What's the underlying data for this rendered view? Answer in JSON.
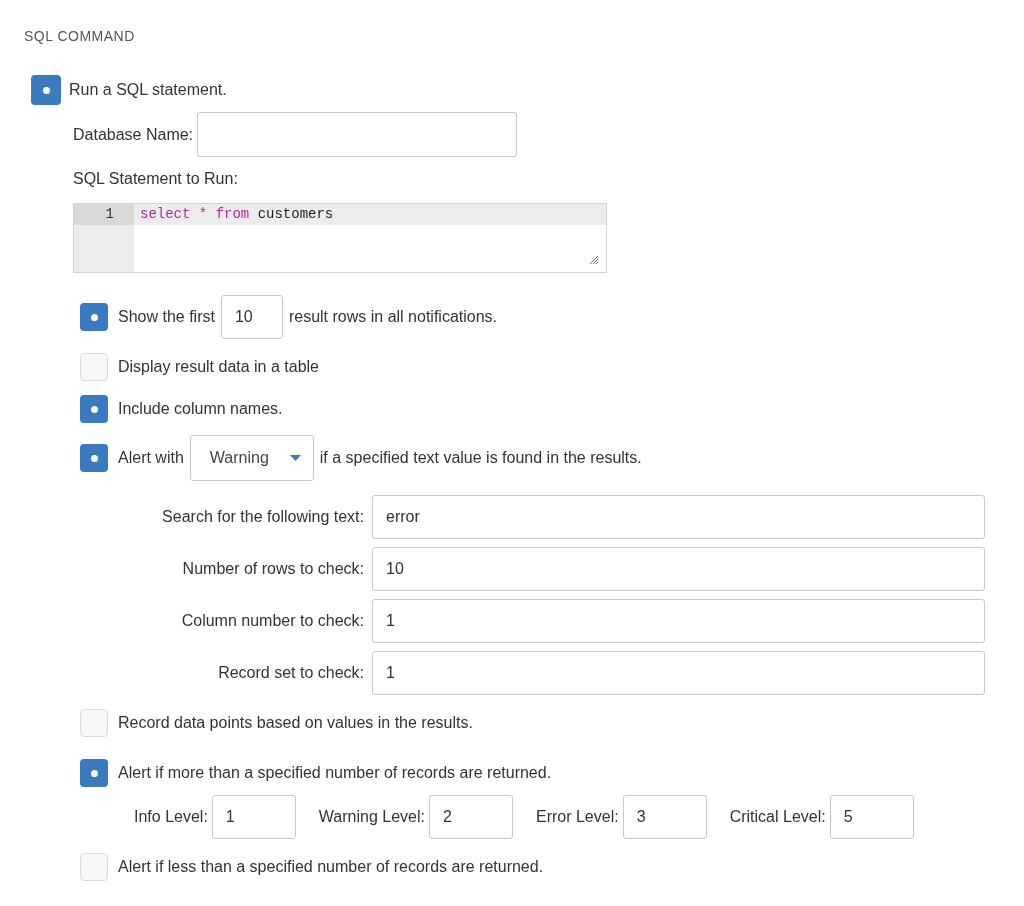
{
  "heading": "SQL COMMAND",
  "run_sql": {
    "label": "Run a SQL statement.",
    "checked": true,
    "database_label": "Database Name:",
    "statement_label": "SQL Statement to Run:",
    "line_number": "1",
    "code_tokens": [
      {
        "kind": "keyword",
        "text": "select"
      },
      {
        "kind": "keyword",
        "text": "*"
      },
      {
        "kind": "keyword",
        "text": "from"
      },
      {
        "kind": "plain",
        "text": "customers"
      }
    ]
  },
  "options": [
    {
      "kind": "inline_input",
      "checked": true,
      "before": "Show the first",
      "value": "10",
      "after": "result rows in all notifications."
    },
    {
      "kind": "plain",
      "checked": false,
      "label": "Display result data in a table"
    },
    {
      "kind": "plain",
      "checked": true,
      "label": "Include column names."
    },
    {
      "kind": "inline_select",
      "checked": true,
      "before": "Alert with",
      "value": "Warning",
      "after": "if a specified text value is found in the results.",
      "fields": [
        {
          "label": "Search for the following text:",
          "value": "error"
        },
        {
          "label": "Number of rows to check:",
          "value": "10"
        },
        {
          "label": "Column number to check:",
          "value": "1"
        },
        {
          "label": "Record set to check:",
          "value": "1"
        }
      ]
    },
    {
      "kind": "plain",
      "checked": false,
      "label": "Record data points based on values in the results."
    },
    {
      "kind": "levels",
      "checked": true,
      "label": "Alert if more than a specified number of records are returned.",
      "levels": [
        {
          "label": "Info Level:",
          "value": "1"
        },
        {
          "label": "Warning Level:",
          "value": "2"
        },
        {
          "label": "Error Level:",
          "value": "3"
        },
        {
          "label": "Critical Level:",
          "value": "5"
        }
      ]
    },
    {
      "kind": "plain",
      "checked": false,
      "label": "Alert if less than a specified number of records are returned."
    }
  ]
}
